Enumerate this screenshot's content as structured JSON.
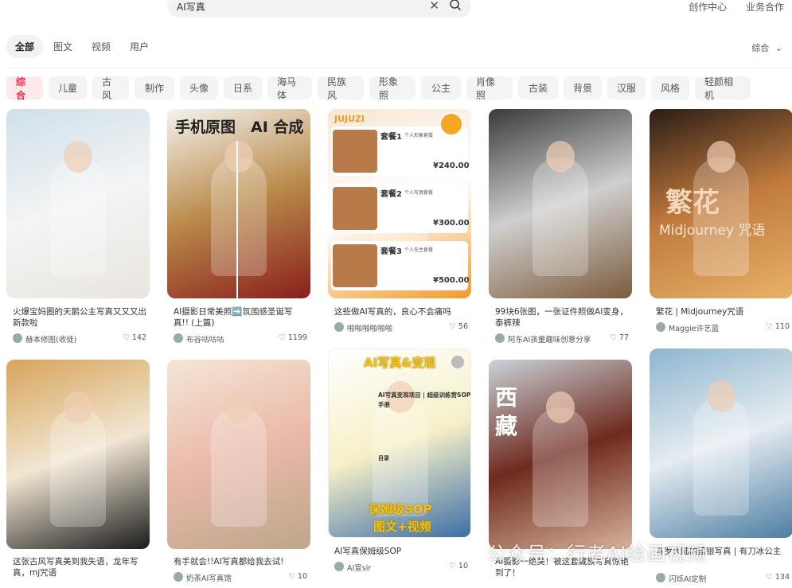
{
  "search": {
    "query": "AI写真"
  },
  "top_links": [
    "创作中心",
    "业务合作"
  ],
  "tabs": [
    "全部",
    "图文",
    "视频",
    "用户"
  ],
  "sort_label": "综合",
  "chips": [
    "综合",
    "儿童",
    "古风",
    "制作",
    "头像",
    "日系",
    "海马体",
    "民族风",
    "形象照",
    "公主",
    "肖像照",
    "古装",
    "背景",
    "汉服",
    "风格",
    "轻颜相机"
  ],
  "cards": [
    {
      "title": "火爆宝妈圈的天鹅公主写真又又又出新款啦",
      "author": "赫本修图(收徒)",
      "likes": "142",
      "palette": [
        "#cfe0ea",
        "#f4f4f4",
        "#e9e5df"
      ]
    },
    {
      "title": "AI摄影日常美照➡️氛围感圣诞写真!! (上篇)",
      "author": "布谷咕咕咕",
      "likes": "1199",
      "palette": [
        "#f5f3ee",
        "#b98a4a",
        "#8a1e1c"
      ],
      "overlay": [
        "手机原图",
        "AI 合成"
      ]
    },
    {
      "title": "这些做AI写真的，良心不会痛吗",
      "author": "啪啪啪啪啪啪",
      "likes": "56",
      "palette": [
        "#f7e7d2",
        "#ffffff",
        "#f39a2b"
      ],
      "overlay": [
        "JUJUZI",
        "套餐1",
        "套餐2",
        "套餐3",
        "¥240.00",
        "¥300.00",
        "¥500.00",
        "个人形象套餐",
        "个人写真套餐",
        "个人先生套餐"
      ]
    },
    {
      "title": "99块6张图，一张证件照做AI变身，泰裤辣",
      "author": "阿东AI孩童趣味创意分享",
      "likes": "77",
      "palette": [
        "#3a3a3a",
        "#cfcfcf",
        "#7c5b3b"
      ]
    },
    {
      "title": "繁花 | Midjourney咒语",
      "author": "Maggie许艺蓝",
      "likes": "110",
      "palette": [
        "#2b1d16",
        "#c17a3d",
        "#e8b26a"
      ],
      "overlay": [
        "繁花",
        "Midjourney 咒语"
      ]
    },
    {
      "title": "这张古风写真美到我失语，龙年写真，mj咒语",
      "author": "",
      "likes": "",
      "palette": [
        "#d7a45a",
        "#f1e6d2",
        "#1b1b1b"
      ]
    },
    {
      "title": "有手就会!!AI写真都给我去试!",
      "author": "奶茶AI写真馆",
      "likes": "10",
      "palette": [
        "#f5e6d5",
        "#eab9a9",
        "#bda68c"
      ]
    },
    {
      "title": "AI写真保姆级SOP",
      "author": "AI宣sir",
      "likes": "10",
      "palette": [
        "#ffffff",
        "#f6f0c8",
        "#3d6ea6"
      ],
      "overlay": [
        "AI写真&变现",
        "AI写真变现项目 | 超级训练营SOP",
        "手册",
        "保姆级SOP",
        "图文+视频",
        "目录"
      ]
    },
    {
      "title": "AI摄影一绝美！被这套藏族写真惊艳到了！",
      "author": "",
      "likes": "",
      "palette": [
        "#cbd3d9",
        "#6e2a1e",
        "#d7b39a"
      ],
      "overlay": [
        "西",
        "藏"
      ]
    },
    {
      "title": "斗罗大陆的蓝银写真 | 有刀冰公主",
      "author": "闪烁AI定制",
      "likes": "134",
      "palette": [
        "#8db6cf",
        "#e6ecf1",
        "#4c7ea3"
      ]
    }
  ],
  "watermark": "公众号：行者AI绘画视频"
}
